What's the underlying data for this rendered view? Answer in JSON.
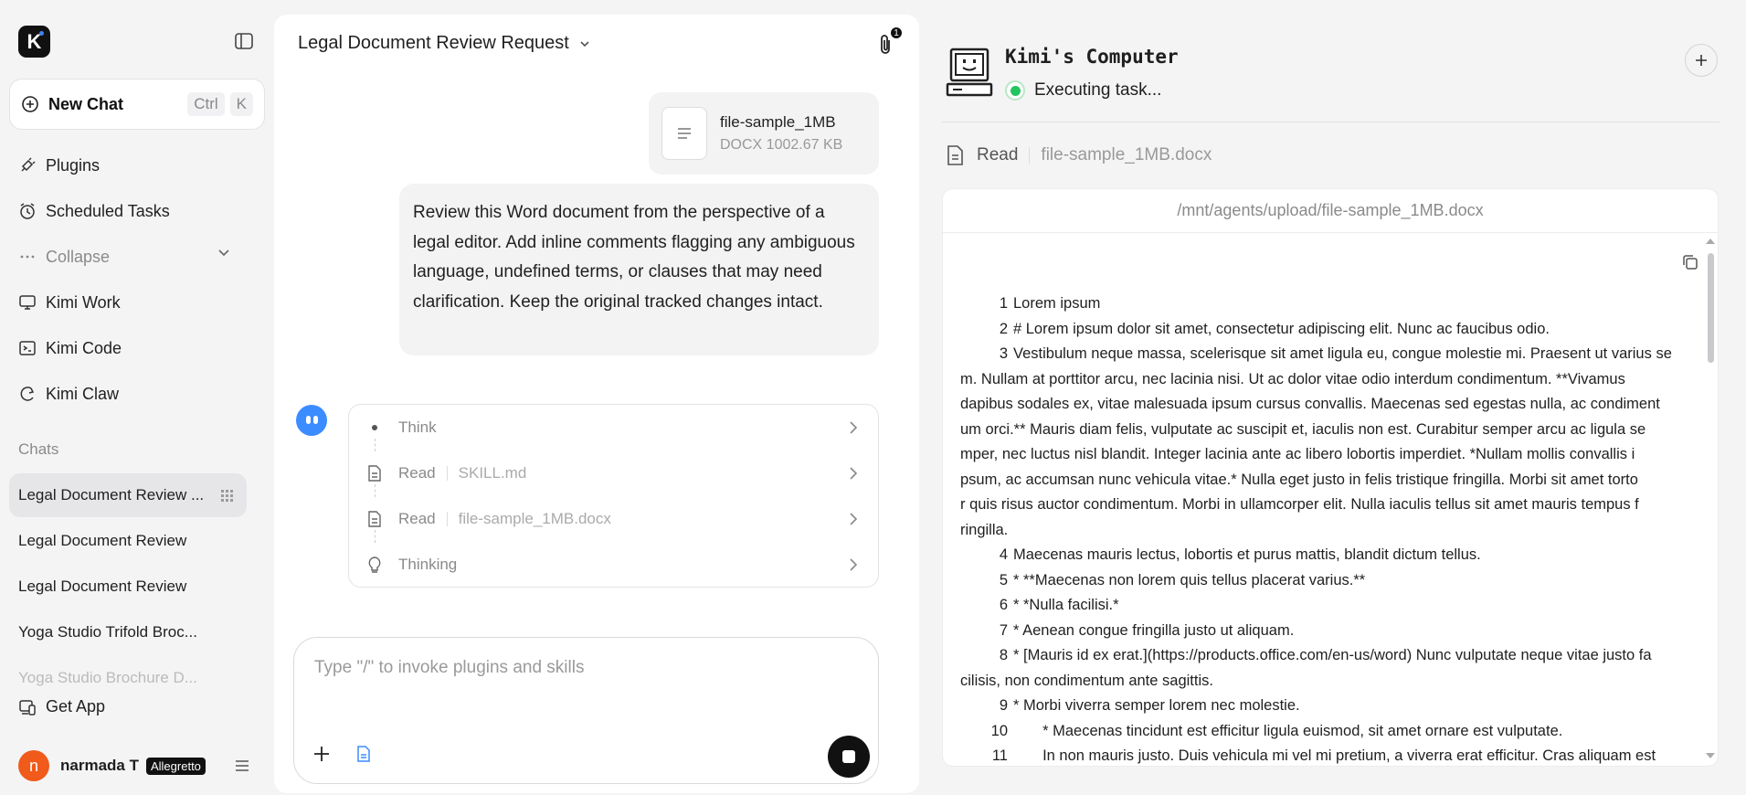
{
  "sidebar": {
    "logo": "K",
    "new_chat": {
      "label": "New Chat",
      "key1": "Ctrl",
      "key2": "K"
    },
    "nav": [
      {
        "label": "Plugins"
      },
      {
        "label": "Scheduled Tasks"
      },
      {
        "label": "Collapse"
      },
      {
        "label": "Kimi Work"
      },
      {
        "label": "Kimi Code"
      },
      {
        "label": "Kimi Claw"
      }
    ],
    "chats_label": "Chats",
    "chats": [
      {
        "label": "Legal Document Review ..."
      },
      {
        "label": "Legal Document Review"
      },
      {
        "label": "Legal Document Review"
      },
      {
        "label": "Yoga Studio Trifold Broc..."
      },
      {
        "label": "Yoga Studio Brochure D..."
      }
    ],
    "get_app": "Get App",
    "user": {
      "initial": "n",
      "name": "narmada T",
      "plan": "Allegretto"
    }
  },
  "main": {
    "title": "Legal Document Review Request",
    "attachment_count": "1",
    "file": {
      "name": "file-sample_1MB",
      "meta": "DOCX 1002.67 KB"
    },
    "message": "Review this Word document from the perspective of a legal editor. Add inline comments flagging any ambiguous language, undefined terms, or clauses that may need clarification. Keep the original tracked changes intact.",
    "steps": [
      {
        "label": "Think",
        "value": ""
      },
      {
        "label": "Read",
        "value": "SKILL.md"
      },
      {
        "label": "Read",
        "value": "file-sample_1MB.docx"
      },
      {
        "label": "Thinking",
        "value": ""
      }
    ],
    "composer_placeholder": "Type \"/\" to invoke plugins and skills"
  },
  "panel": {
    "title": "Kimi's Computer",
    "status": "Executing task...",
    "action_label": "Read",
    "action_value": "file-sample_1MB.docx",
    "path": "/mnt/agents/upload/file-sample_1MB.docx",
    "lines": [
      {
        "n": "1",
        "t": "Lorem ipsum"
      },
      {
        "n": "2",
        "t": "# Lorem ipsum dolor sit amet, consectetur adipiscing elit. Nunc ac faucibus odio."
      },
      {
        "n": "3",
        "t": "Vestibulum neque massa, scelerisque sit amet ligula eu, congue molestie mi. Praesent ut varius se"
      },
      {
        "n": "",
        "t": "m. Nullam at porttitor arcu, nec lacinia nisi. Ut ac dolor vitae odio interdum condimentum. **Vivamus"
      },
      {
        "n": "",
        "t": "dapibus sodales ex, vitae malesuada ipsum cursus convallis. Maecenas sed egestas nulla, ac condiment"
      },
      {
        "n": "",
        "t": "um orci.** Mauris diam felis, vulputate ac suscipit et, iaculis non est. Curabitur semper arcu ac ligula se"
      },
      {
        "n": "",
        "t": "mper, nec luctus nisl blandit. Integer lacinia ante ac libero lobortis imperdiet. *Nullam mollis convallis i"
      },
      {
        "n": "",
        "t": "psum, ac accumsan nunc vehicula vitae.* Nulla eget justo in felis tristique fringilla. Morbi sit amet torto"
      },
      {
        "n": "",
        "t": "r quis risus auctor condimentum. Morbi in ullamcorper elit. Nulla iaculis tellus sit amet mauris tempus f"
      },
      {
        "n": "",
        "t": "ringilla."
      },
      {
        "n": "4",
        "t": "Maecenas mauris lectus, lobortis et purus mattis, blandit dictum tellus."
      },
      {
        "n": "5",
        "t": "* **Maecenas non lorem quis tellus placerat varius.**"
      },
      {
        "n": "6",
        "t": "* *Nulla facilisi.*"
      },
      {
        "n": "7",
        "t": "* Aenean congue fringilla justo ut aliquam."
      },
      {
        "n": "8",
        "t": "* [Mauris id ex erat.](https://products.office.com/en-us/word) Nunc vulputate neque vitae justo fa"
      },
      {
        "n": "",
        "t": "cilisis, non condimentum ante sagittis."
      },
      {
        "n": "9",
        "t": "* Morbi viverra semper lorem nec molestie."
      },
      {
        "n": "10",
        "t": "    * Maecenas tincidunt est efficitur ligula euismod, sit amet ornare est vulputate."
      },
      {
        "n": "11",
        "t": "    In non mauris justo. Duis vehicula mi vel mi pretium, a viverra erat efficitur. Cras aliquam est"
      }
    ]
  },
  "colors": {
    "accent_blue": "#3b8cff",
    "status_green": "#22c55e",
    "avatar_orange": "#f05a1a"
  }
}
